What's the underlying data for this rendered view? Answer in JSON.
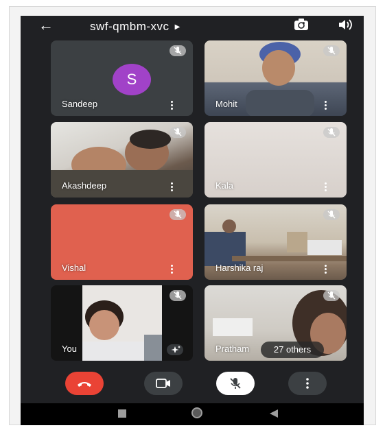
{
  "meeting": {
    "code": "swf-qmbm-xvc"
  },
  "icons": {
    "back": "arrow-left-icon",
    "meeting_info": "caret-right-icon",
    "switch_camera": "camera-flip-icon",
    "audio": "speaker-icon",
    "mic_off": "mic-off-icon",
    "more": "more-vertical-icon",
    "end_call": "phone-hangup-icon",
    "camera": "video-camera-icon",
    "effects": "sparkle-icon"
  },
  "participants": [
    {
      "name": "Sandeep",
      "avatar_letter": "S",
      "muted": true
    },
    {
      "name": "Mohit",
      "muted": true
    },
    {
      "name": "Akashdeep",
      "muted": true
    },
    {
      "name": "Kala",
      "muted": true
    },
    {
      "name": "Vishal",
      "muted": true
    },
    {
      "name": "Harshika raj",
      "muted": true
    },
    {
      "name": "You",
      "muted": true
    },
    {
      "name": "Pratham",
      "muted": true
    }
  ],
  "others_label": "27 others",
  "colors": {
    "background": "#202124",
    "tile": "#3c4043",
    "avatar": "#a142c8",
    "vishal_tile": "#e0614f",
    "end_call": "#ea4335",
    "control_dark": "#3c4043",
    "mic_control": "#ffffff"
  }
}
